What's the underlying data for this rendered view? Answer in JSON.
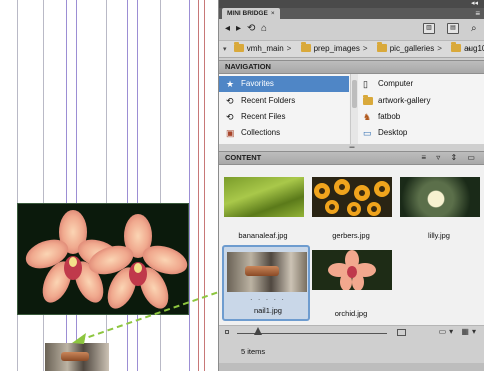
{
  "panel": {
    "title": "MINI BRIDGE",
    "tab_close": "×",
    "menu": "≡",
    "collapse": "◂◂"
  },
  "toolbar": {
    "back": "◂",
    "forward": "▸",
    "go_up": "⟲",
    "home": "⌂",
    "view_box_1": "▥",
    "view_box_2": "▤",
    "search": "⌕"
  },
  "path": {
    "crumbs": [
      "vmh_main",
      "prep_images",
      "pic_galleries",
      "aug10"
    ],
    "separator": ">",
    "more": "»",
    "expand": "▾"
  },
  "navigation": {
    "header": "NAVIGATION",
    "left_items": [
      {
        "label": "Favorites",
        "icon": "star-icon",
        "glyph": "★"
      },
      {
        "label": "Recent Folders",
        "icon": "recent-folders-icon",
        "glyph": "⟲"
      },
      {
        "label": "Recent Files",
        "icon": "recent-files-icon",
        "glyph": "⟲"
      },
      {
        "label": "Collections",
        "icon": "collections-icon",
        "glyph": "▣"
      }
    ],
    "right_items": [
      {
        "label": "Computer",
        "icon": "computer-icon",
        "glyph": "▯"
      },
      {
        "label": "artwork-gallery",
        "icon": "folder-icon",
        "glyph": ""
      },
      {
        "label": "fatbob",
        "icon": "user-icon",
        "glyph": "♞"
      },
      {
        "label": "Desktop",
        "icon": "desktop-icon",
        "glyph": "▭"
      }
    ]
  },
  "content": {
    "header": "CONTENT",
    "tools": "≡ ▿ ⇕ ▭",
    "items": [
      {
        "name": "bananaleaf.jpg",
        "thumb": "th-banana",
        "selected": false
      },
      {
        "name": "gerbers.jpg",
        "thumb": "th-gerbers",
        "selected": false
      },
      {
        "name": "lilly.jpg",
        "thumb": "th-lily",
        "selected": false
      },
      {
        "name": "nail1.jpg",
        "thumb": "th-nail",
        "selected": true
      },
      {
        "name": "orchid.jpg",
        "thumb": "th-orchid",
        "selected": false
      }
    ],
    "selection_dots": ". . . . ."
  },
  "status": {
    "item_count": "5 items",
    "tools": "▭▾ ▦▾"
  },
  "colors": {
    "selection_blue": "#4f86c6",
    "drag_arrow": "#8dc63f",
    "guide_purple": "#9c8ed4"
  }
}
